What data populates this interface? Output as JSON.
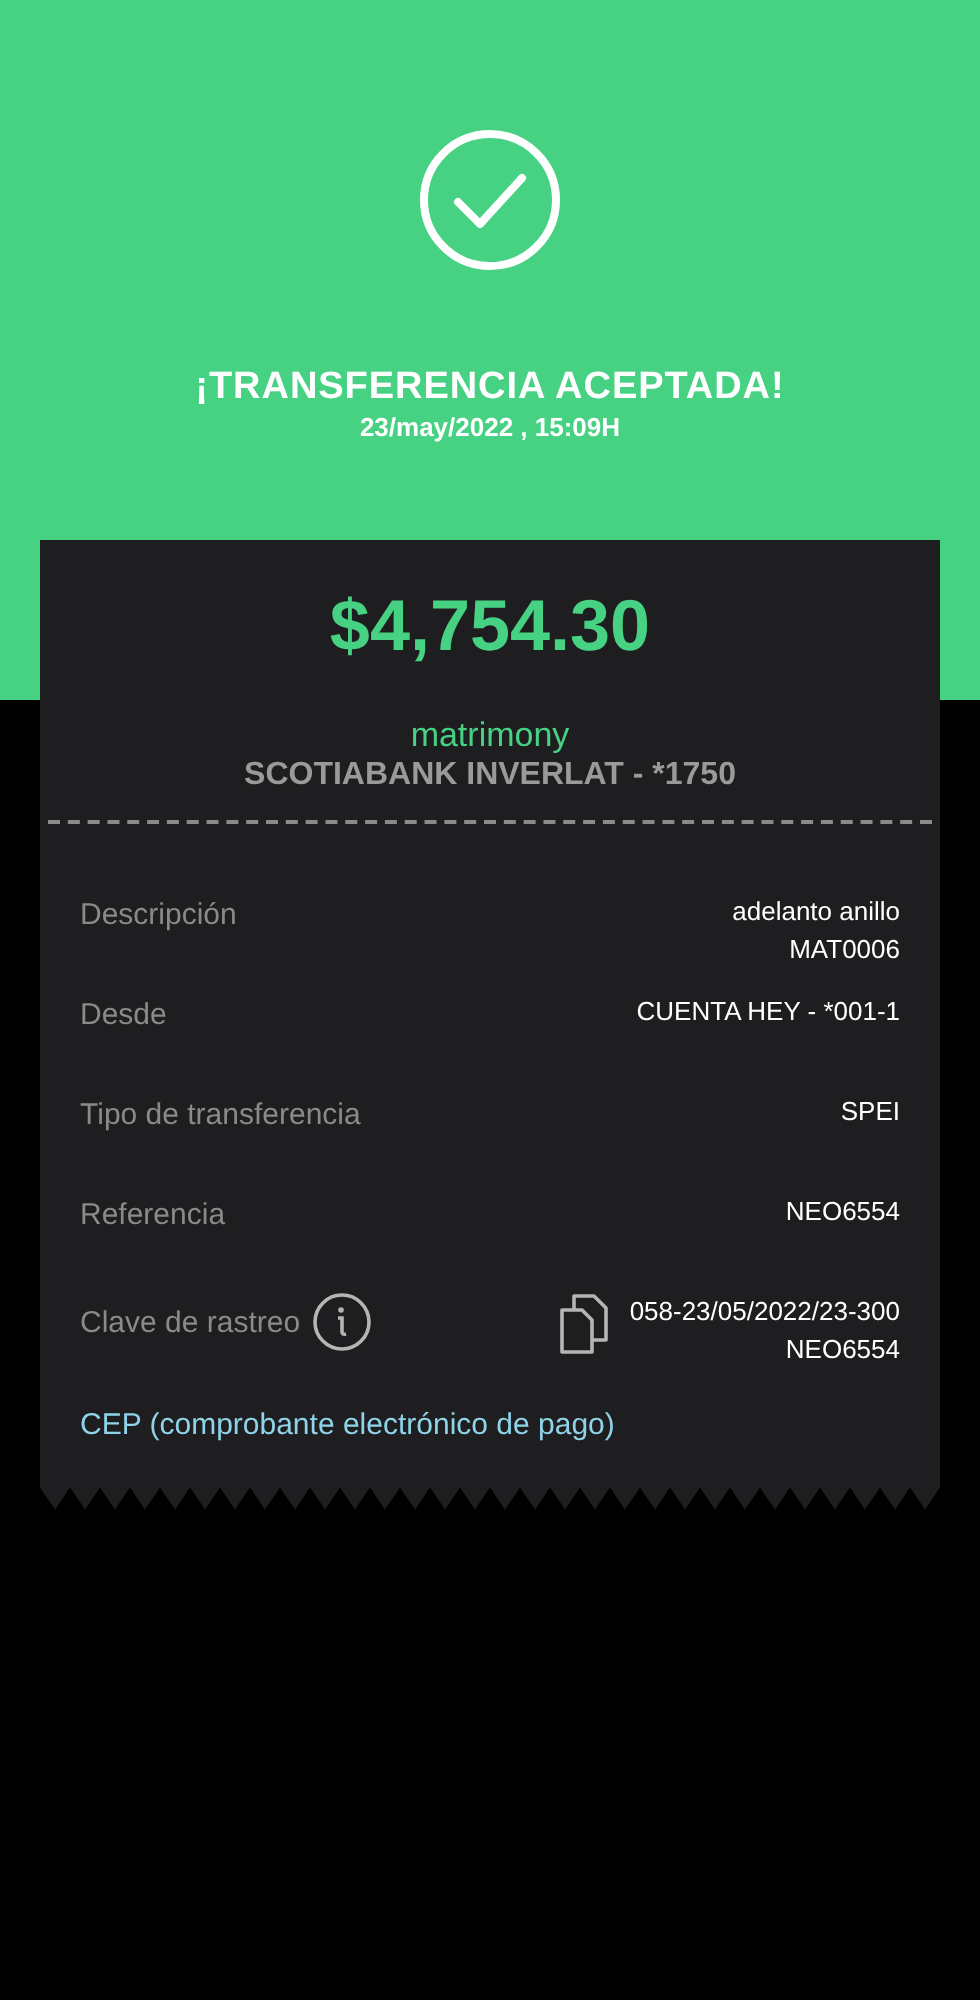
{
  "header": {
    "title": "¡TRANSFERENCIA ACEPTADA!",
    "datetime": "23/may/2022 , 15:09H"
  },
  "receipt": {
    "amount": "$4,754.30",
    "recipient": "matrimony",
    "bank": "SCOTIABANK INVERLAT - *1750",
    "rows": [
      {
        "kind": "plain",
        "label": "Descripción",
        "value": [
          "adelanto anillo",
          "MAT0006"
        ]
      },
      {
        "kind": "plain",
        "label": "Desde",
        "value": [
          "CUENTA HEY - *001-1"
        ]
      },
      {
        "kind": "plain",
        "label": "Tipo de transferencia",
        "value": [
          "SPEI"
        ]
      },
      {
        "kind": "plain",
        "label": "Referencia",
        "value": [
          "NEO6554"
        ]
      },
      {
        "kind": "tracking",
        "label": "Clave de rastreo",
        "value": [
          "058-23/05/2022/23-300",
          "NEO6554"
        ]
      }
    ],
    "link": "CEP (comprobante electrónico de pago)"
  }
}
